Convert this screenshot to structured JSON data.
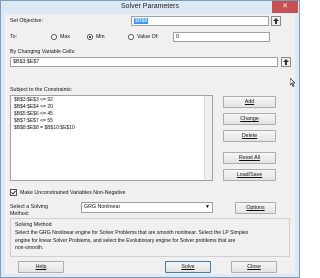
{
  "window": {
    "title": "Solver Parameters",
    "close_glyph": "✕"
  },
  "objective": {
    "label": "Set Objective:",
    "value": "$B$8"
  },
  "to": {
    "label": "To:",
    "options": [
      {
        "label": "Max",
        "selected": false
      },
      {
        "label": "Min",
        "selected": true
      },
      {
        "label": "Value Of:",
        "selected": false
      }
    ],
    "value_of": "0"
  },
  "variable_cells": {
    "label": "By Changing Variable Cells:",
    "value": "$B$3:$E$7"
  },
  "constraints": {
    "label": "Subject to the Constraints:",
    "items": [
      "$B$3:$E$3 <= 92",
      "$B$4:$E$4 <= 20",
      "$B$5:$E$6 <= 45",
      "$B$7:$E$7 <= 55",
      "$B$8:$E$8 = $B$10:$E$10"
    ]
  },
  "buttons": {
    "add": "Add",
    "change": "Change",
    "delete": "Delete",
    "reset_all": "Reset All",
    "load_save": "Load/Save",
    "options": "Options",
    "help": "Help",
    "solve": "Solve",
    "close": "Close"
  },
  "nonnegative": {
    "label": "Make Unconstrained Variables Non-Negative",
    "checked": true
  },
  "solving_method": {
    "label_line1": "Select a Solving",
    "label_line2": "Method:",
    "selected": "GRG Nonlinear"
  },
  "method_box": {
    "title": "Solving Method",
    "description_lines": [
      "Select the GRG Nonlinear engine for Solver Problems that are smooth nonlinear. Select the LP Simplex",
      "engine for linear Solver Problems, and select the Evolutionary engine for Solver problems that are",
      "non-smooth."
    ]
  }
}
